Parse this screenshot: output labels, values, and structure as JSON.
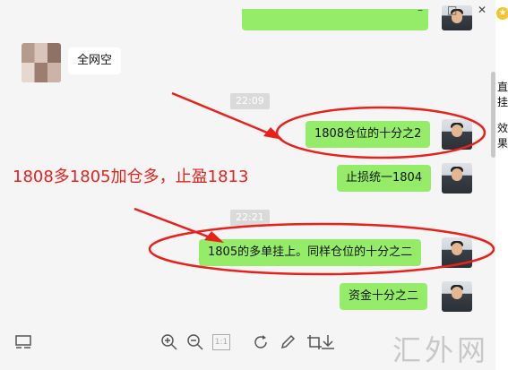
{
  "window": {
    "min_icon": "minimize-icon",
    "max_icon": "maximize-icon",
    "close_icon": "close-icon",
    "min_glyph": "–",
    "max_glyph": "□",
    "close_glyph": "✕"
  },
  "contact": {
    "name": "全网空"
  },
  "times": [
    "22:09",
    "22:21"
  ],
  "messages": [
    {
      "from": "self",
      "text": "1808仓位的十分之2"
    },
    {
      "from": "self",
      "text": "止损统一1804"
    },
    {
      "from": "self",
      "text": "1805的多单挂上。同样仓位的十分之二"
    },
    {
      "from": "self",
      "text": "资金十分之二"
    }
  ],
  "annotation": {
    "text": "1808多1805加仓多，止盈1813",
    "color": "#e8211b"
  },
  "side_fragments": [
    "直挂",
    "效果"
  ],
  "toolbar": {
    "icons": [
      "layout-icon",
      "zoom-in-icon",
      "zoom-out-icon",
      "actual-size-icon",
      "rotate-icon",
      "edit-icon",
      "crop-icon",
      "download-icon"
    ],
    "actual_size_label": "1:1"
  },
  "watermark": "汇外网",
  "colors": {
    "bubble_self": "#95ec69",
    "bubble_other": "#ffffff",
    "background": "#f5f5f5"
  }
}
